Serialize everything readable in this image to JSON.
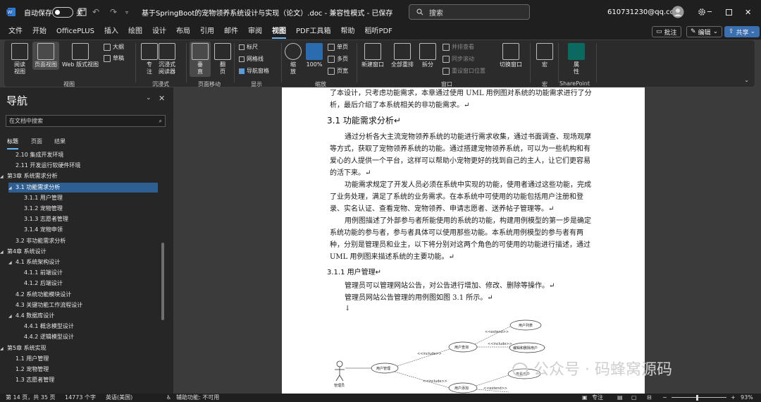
{
  "titlebar": {
    "autosave_label": "自动保存",
    "autosave_state": "关",
    "doc_title": "基于SpringBoot的宠物领养系统设计与实现（论文）.doc - 兼容性模式 - 已保存",
    "search_placeholder": "搜索",
    "account": "610731230@qq.com"
  },
  "menu": {
    "tabs": [
      "文件",
      "开始",
      "OfficePLUS",
      "插入",
      "绘图",
      "设计",
      "布局",
      "引用",
      "邮件",
      "审阅",
      "视图",
      "PDF工具箱",
      "帮助",
      "稻听PDF"
    ],
    "active": "视图"
  },
  "top_buttons": {
    "comments": "批注",
    "editing": "编辑",
    "share": "共享"
  },
  "ribbon": {
    "views": {
      "read": "阅读\n视图",
      "print": "页面视图",
      "web": "Web 版式视图",
      "outline": "大纲",
      "draft": "草稿",
      "group": "视图"
    },
    "immersive": {
      "focus": "专\n注",
      "reader": "沉浸式\n阅读器",
      "group": "沉浸式"
    },
    "pagemove": {
      "vertical": "垂\n直",
      "side": "翻\n页",
      "group": "页面移动"
    },
    "show": {
      "ruler": "标尺",
      "gridlines": "网格线",
      "navpane": "导航窗格",
      "group": "显示"
    },
    "zoom": {
      "zoom": "缩\n放",
      "zoom100": "100%",
      "onepage": "单页",
      "multipage": "多页",
      "pagewidth": "页宽",
      "group": "缩放"
    },
    "window": {
      "newwin": "新建窗口",
      "arrange": "全部重排",
      "split": "拆分",
      "sidebyside": "并排查看",
      "syncscroll": "同步滚动",
      "resetpos": "重设窗口位置",
      "switch": "切换窗口",
      "group": "窗口"
    },
    "macro": {
      "macro": "宏",
      "group": "宏"
    },
    "sharepoint": {
      "props": "属\n性",
      "group": "SharePoint"
    }
  },
  "nav": {
    "title": "导航",
    "search_placeholder": "在文档中搜索",
    "tabs": [
      "标题",
      "页面",
      "结果"
    ],
    "tree": [
      {
        "label": "2.10 集成开发环境",
        "lvl": 2,
        "tw": ""
      },
      {
        "label": "2.11 开发运行软硬件环境",
        "lvl": 2,
        "tw": ""
      },
      {
        "label": "第3章 系统需求分析",
        "lvl": 1,
        "tw": "◢"
      },
      {
        "label": "3.1 功能需求分析",
        "lvl": 2,
        "tw": "◢",
        "sel": true
      },
      {
        "label": "3.1.1 用户管理",
        "lvl": 3,
        "tw": ""
      },
      {
        "label": "3.1.2 宠物管理",
        "lvl": 3,
        "tw": ""
      },
      {
        "label": "3.1.3 志愿者管理",
        "lvl": 3,
        "tw": ""
      },
      {
        "label": "3.1.4 宠物申领",
        "lvl": 3,
        "tw": ""
      },
      {
        "label": "3.2 非功能需求分析",
        "lvl": 2,
        "tw": ""
      },
      {
        "label": "第4章 系统设计",
        "lvl": 1,
        "tw": "◢"
      },
      {
        "label": "4.1 系统架构设计",
        "lvl": 2,
        "tw": "◢"
      },
      {
        "label": "4.1.1 前端设计",
        "lvl": 3,
        "tw": ""
      },
      {
        "label": "4.1.2 后端设计",
        "lvl": 3,
        "tw": ""
      },
      {
        "label": "4.2 系统功能模块设计",
        "lvl": 2,
        "tw": ""
      },
      {
        "label": "4.3 关键功能工作流程设计",
        "lvl": 2,
        "tw": ""
      },
      {
        "label": "4.4 数据库设计",
        "lvl": 2,
        "tw": "◢"
      },
      {
        "label": "4.4.1 概念模型设计",
        "lvl": 3,
        "tw": ""
      },
      {
        "label": "4.4.2 逻辑模型设计",
        "lvl": 3,
        "tw": ""
      },
      {
        "label": "第5章 系统实现",
        "lvl": 1,
        "tw": "◢"
      },
      {
        "label": "1.1 用户管理",
        "lvl": 2,
        "tw": ""
      },
      {
        "label": "1.2 宠物管理",
        "lvl": 2,
        "tw": ""
      },
      {
        "label": "1.3 志愿者管理",
        "lvl": 2,
        "tw": ""
      }
    ]
  },
  "document": {
    "p0a": "了本设计，只考虑功能需求，本章通过使用 UML 用例图对系统的功能需求进行了分",
    "p0b": "析，最后介绍了本系统相关的非功能需求。↵",
    "h31": "3.1   功能需求分析↵",
    "p1a": "通过分析各大主流宠物领养系统的功能进行需求收集，通过书面调查、现场观摩",
    "p1b": "等方式，获取了宠物领养系统的功能。通过搭建宠物领养系统，可以为一些机构和有",
    "p1c": "爱心的人提供一个平台，这样可以帮助小宠物更好的找到自己的主人，让它们更容易",
    "p1d": "的活下来。↵",
    "p2a": "功能需求规定了开发人员必须在系统中实现的功能，使用者通过这些功能，完成",
    "p2b": "了业务处理，满足了系统的业务需求。在本系统中可使用的功能包括用户注册和登",
    "p2c": "录、实名认证、查看宠物、宠物领养、申请志愿者、送养帖子管理等。↵",
    "p3a": "用例图描述了外部参与者所能使用的系统的功能，构建用例模型的第一步是确定",
    "p3b": "系统功能的参与者，参与者具体可以使用那些功能。本系统用例模型的参与者有两",
    "p3c": "种，分别是管理员和业主，以下将分别对这两个角色的可使用的功能进行描述，通过",
    "p3d": "UML 用例图来描述系统的主要功能。↵",
    "h311": "3.1.1   用户管理↵",
    "p4": "管理员可以管理网站公告，对公告进行增加、修改、删除等操作。↵",
    "p5": "管理员网站公告管理的用例图如图 3.1 所示。↵",
    "p6": "↓",
    "uml": {
      "actor": "管理员",
      "uc_manage": "用户管理",
      "uc_query": "用户查询",
      "uc_add": "用户添加",
      "uc_list": "用户列表",
      "uc_edit": "编辑和删除用户",
      "uc_e": "查看用户",
      "include": "<<include>>",
      "extend": "<<extend>>"
    }
  },
  "statusbar": {
    "page": "第 14 页，共 35 页",
    "words": "14773 个字",
    "lang": "英语(美国)",
    "access": "辅助功能: 不可用",
    "focus": "专注",
    "zoom": "93%"
  },
  "watermark": "公众号 · 码蜂窝源码"
}
